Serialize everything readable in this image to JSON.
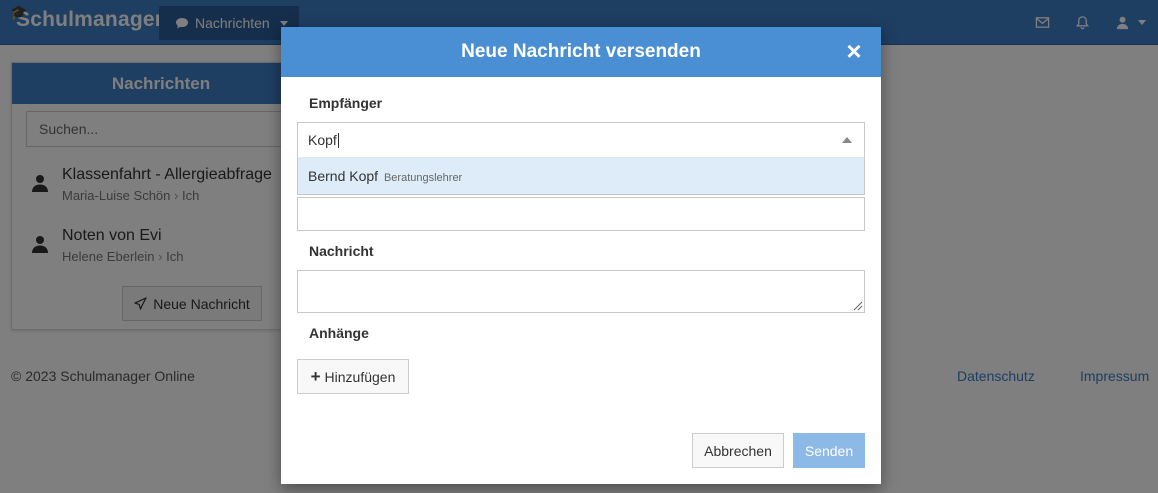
{
  "app": {
    "brand": "Schulmanager",
    "nav_dropdown_label": "Nachrichten",
    "icons": {
      "mail": "mail-icon",
      "bell": "bell-icon",
      "user": "user-icon",
      "chat": "chat-icon",
      "cap": "graduation-cap-icon"
    }
  },
  "sidebar": {
    "heading": "Nachrichten",
    "search_placeholder": "Suchen...",
    "messages": [
      {
        "title": "Klassenfahrt - Allergieabfrage",
        "from": "Maria-Luise Schön",
        "to": "Ich"
      },
      {
        "title": "Noten von Evi",
        "from": "Helene Eberlein",
        "to": "Ich"
      }
    ],
    "new_message_label": "Neue Nachricht"
  },
  "footer": {
    "copyright": "© 2023 Schulmanager Online",
    "links": [
      "Datenschutz",
      "Impressum"
    ]
  },
  "modal": {
    "title": "Neue Nachricht versenden",
    "close_symbol": "×",
    "recipient_label": "Empfänger",
    "recipient_value": "Kopf",
    "dropdown_option": {
      "name": "Bernd Kopf",
      "role": "Beratungslehrer"
    },
    "message_label": "Nachricht",
    "attachments_label": "Anhänge",
    "add_button": "Hinzufügen",
    "cancel_button": "Abbrechen",
    "send_button": "Senden"
  },
  "colors": {
    "primary": "#3c7dc4",
    "modal_header": "#4a8fd4",
    "send_disabled": "#8db9e6",
    "option_highlight": "#deebf9"
  }
}
